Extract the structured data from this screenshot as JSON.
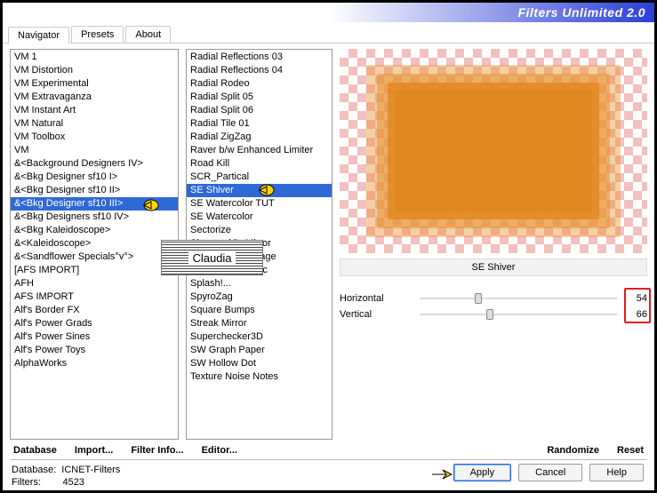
{
  "title": "Filters Unlimited 2.0",
  "tabs": {
    "navigator": "Navigator",
    "presets": "Presets",
    "about": "About"
  },
  "categories": [
    "VM 1",
    "VM Distortion",
    "VM Experimental",
    "VM Extravaganza",
    "VM Instant Art",
    "VM Natural",
    "VM Toolbox",
    "VM",
    "&<Background Designers IV>",
    "&<Bkg Designer sf10 I>",
    "&<Bkg Designer sf10 II>",
    "&<Bkg Designer sf10 III>",
    "&<Bkg Designers sf10 IV>",
    "&<Bkg Kaleidoscope>",
    "&<Kaleidoscope>",
    "&<Sandflower Specials°v°>",
    "[AFS IMPORT]",
    "AFH",
    "AFS IMPORT",
    "Alf's Border FX",
    "Alf's Power Grads",
    "Alf's Power Sines",
    "Alf's Power Toys",
    "AlphaWorks"
  ],
  "categories_selected_index": 11,
  "filters": [
    "Radial Reflections 03",
    "Radial Reflections 04",
    "Radial Rodeo",
    "Radial Split 05",
    "Radial Split 06",
    "Radial Tile 01",
    "Radial ZigZag",
    "Raver b/w Enhanced Limiter",
    "Road Kill",
    "SCR_Partical",
    "SE Shiver",
    "SE Watercolor TUT",
    "SE Watercolor",
    "Sectorize",
    "Sierpenski's Mirror",
    "SIM 4 Way Average",
    "Solid Solar Fabric",
    "Splash!...",
    "SpyroZag",
    "Square Bumps",
    "Streak Mirror",
    "Superchecker3D",
    "SW Graph Paper",
    "SW Hollow Dot",
    "Texture Noise Notes"
  ],
  "filters_selected_index": 10,
  "selected_filter_name": "SE Shiver",
  "watermark": "Claudia",
  "params": {
    "horizontal": {
      "label": "Horizontal",
      "value": "54"
    },
    "vertical": {
      "label": "Vertical",
      "value": "66"
    }
  },
  "links": {
    "database": "Database",
    "import": "Import...",
    "filterinfo": "Filter Info...",
    "editor": "Editor...",
    "randomize": "Randomize",
    "reset": "Reset"
  },
  "status": {
    "db_label": "Database:",
    "db_value": "ICNET-Filters",
    "filters_label": "Filters:",
    "filters_value": "4523"
  },
  "buttons": {
    "apply": "Apply",
    "cancel": "Cancel",
    "help": "Help"
  }
}
